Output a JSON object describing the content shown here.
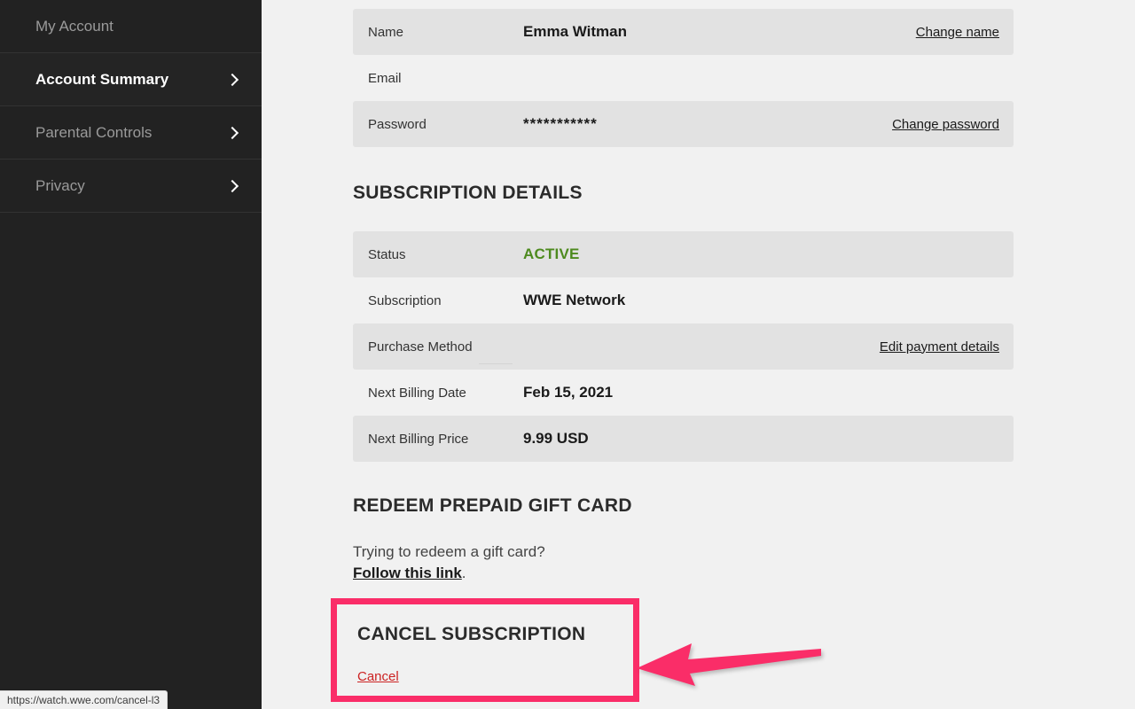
{
  "sidebar": {
    "items": [
      {
        "label": "My Account",
        "active": false,
        "chevron": false
      },
      {
        "label": "Account Summary",
        "active": true,
        "chevron": true
      },
      {
        "label": "Parental Controls",
        "active": false,
        "chevron": true
      },
      {
        "label": "Privacy",
        "active": false,
        "chevron": true
      }
    ]
  },
  "account": {
    "rows": [
      {
        "label": "Name",
        "value": "Emma Witman",
        "action": "Change name"
      },
      {
        "label": "Email",
        "value": "",
        "action": ""
      },
      {
        "label": "Password",
        "value": "***********",
        "action": "Change password"
      }
    ]
  },
  "subscription": {
    "heading": "SUBSCRIPTION DETAILS",
    "status_label": "Status",
    "status_value": "ACTIVE",
    "subscription_label": "Subscription",
    "subscription_value": "WWE Network",
    "purchase_label": "Purchase Method",
    "purchase_action": "Edit payment details",
    "billing_date_label": "Next Billing Date",
    "billing_date_value": "Feb 15, 2021",
    "billing_price_label": "Next Billing Price",
    "billing_price_value": "9.99 USD"
  },
  "giftcard": {
    "heading": "REDEEM PREPAID GIFT CARD",
    "question": "Trying to redeem a gift card?",
    "link": "Follow this link",
    "period": "."
  },
  "cancel": {
    "heading": "CANCEL SUBSCRIPTION",
    "link": "Cancel"
  },
  "statusbar": {
    "url": "https://watch.wwe.com/cancel-l3"
  },
  "colors": {
    "annotation_pink": "#fa2d68",
    "status_green": "#4d8a1e",
    "cancel_red": "#cc2222",
    "sidebar_bg": "#222222",
    "page_bg": "#f1f1f1",
    "row_alt_bg": "#e2e2e2"
  }
}
